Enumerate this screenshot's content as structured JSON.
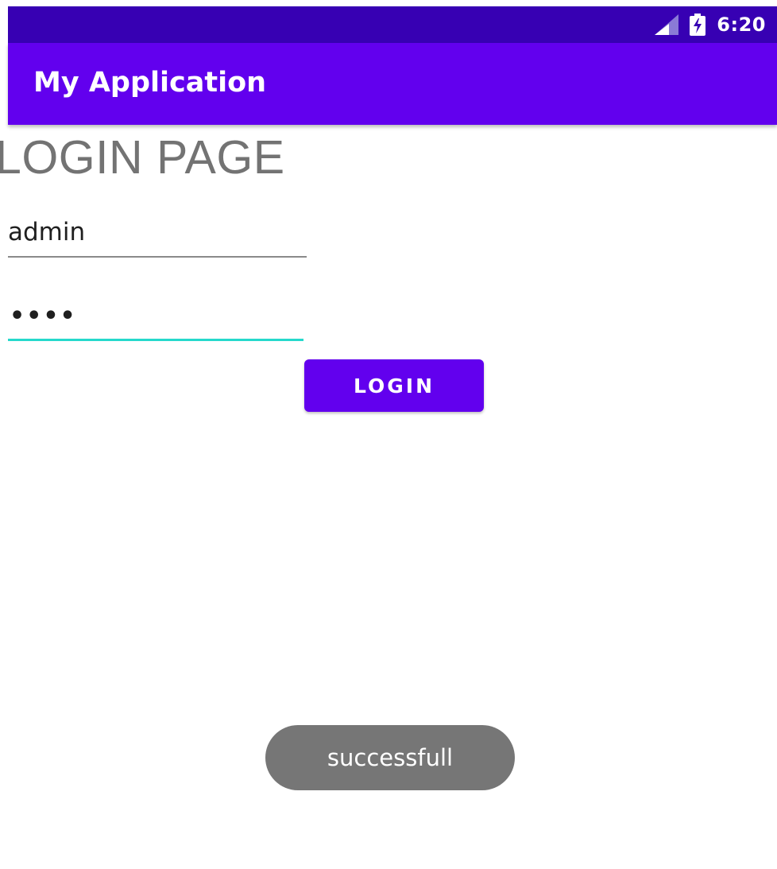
{
  "status_bar": {
    "time": "6:20",
    "signal_icon": "signal-icon",
    "battery_icon": "battery-charging-icon",
    "color": "#3700b3"
  },
  "app_bar": {
    "title": "My Application",
    "color": "#6200ee"
  },
  "main": {
    "heading": "LOGIN PAGE",
    "username": {
      "value": "admin"
    },
    "password": {
      "masked_value": "••••",
      "focus_color": "#26d9cc"
    },
    "login_button": {
      "label": "LOGIN"
    }
  },
  "toast": {
    "message": "successfull"
  }
}
